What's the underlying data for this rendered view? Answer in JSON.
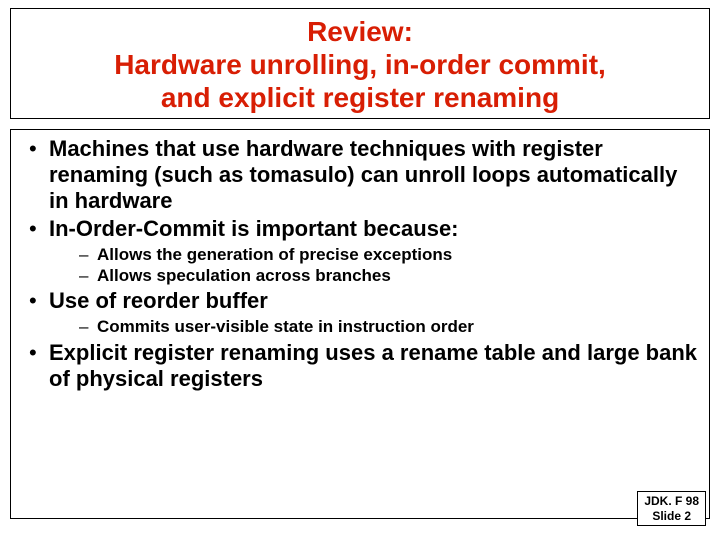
{
  "title": {
    "line1": "Review:",
    "line2": "Hardware unrolling, in-order commit,",
    "line3": "and explicit register renaming"
  },
  "bullets": {
    "b1": "Machines that use hardware techniques with register renaming (such as tomasulo) can unroll loops automatically in hardware",
    "b2": "In-Order-Commit is important because:",
    "b2_sub1": "Allows the generation of precise exceptions",
    "b2_sub2": "Allows speculation across branches",
    "b3": "Use of reorder buffer",
    "b3_sub1": "Commits user-visible state in instruction order",
    "b4": "Explicit register renaming uses a rename table and large bank of physical registers"
  },
  "footer": {
    "line1": "JDK. F 98",
    "line2": "Slide 2"
  }
}
